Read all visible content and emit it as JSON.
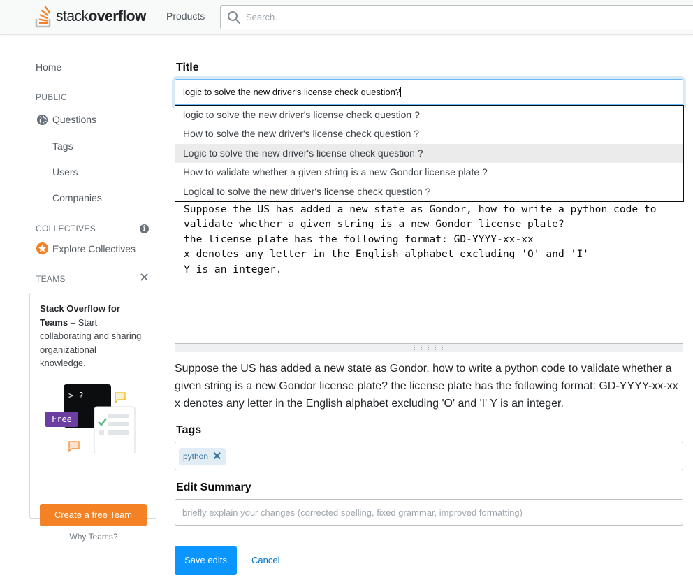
{
  "header": {
    "logo_text_light": "stack",
    "logo_text_bold": "overflow",
    "products_label": "Products",
    "search_placeholder": "Search…",
    "logo_color": "#f48024"
  },
  "sidebar": {
    "home": "Home",
    "public_heading": "PUBLIC",
    "public_items": [
      "Questions",
      "Tags",
      "Users",
      "Companies"
    ],
    "collectives_heading": "COLLECTIVES",
    "explore_collectives": "Explore Collectives",
    "teams_heading": "TEAMS",
    "teams_promo_bold": "Stack Overflow for Teams",
    "teams_promo_rest": " – Start collaborating and sharing organizational knowledge.",
    "illustration_free_badge": "Free",
    "illustration_prompt": ">_?",
    "create_team_button": "Create a free Team",
    "why_teams_link": "Why Teams?"
  },
  "form": {
    "title_label": "Title",
    "title_value": "logic to solve the new driver's license check question?",
    "suggestions": [
      "logic to solve the new driver's license check question ?",
      "How to solve the new driver's license check question ?",
      "Logic to solve the new driver's license check question ?",
      "How to validate whether a given string is a new Gondor license plate ?",
      "Logical to solve the new driver's license check question ?"
    ],
    "highlighted_suggestion_index": 2,
    "body_lines": [
      "Suppose the US has added a new state as Gondor, how to write a python code to",
      "validate whether a given string is a new Gondor license plate?",
      "the license plate has the following format: GD-YYYY-xx-xx",
      "x denotes any letter in the English alphabet excluding 'O' and 'I'",
      "Y is an integer."
    ],
    "preview_text": "Suppose the US has added a new state as Gondor, how to write a python code to validate whether a given string is a new Gondor license plate? the license plate has the following format: GD-YYYY-xx-xx x denotes any letter in the English alphabet excluding 'O' and 'I' Y is an integer.",
    "tags_label": "Tags",
    "tags": [
      "python"
    ],
    "edit_summary_label": "Edit Summary",
    "edit_summary_placeholder": "briefly explain your changes (corrected spelling, fixed grammar, improved formatting)",
    "save_button": "Save edits",
    "cancel_link": "Cancel"
  },
  "colors": {
    "primary_button": "#0a95ff",
    "orange_button": "#f48225",
    "link": "#0074cc",
    "tag_bg": "#e1ecf4",
    "tag_text": "#39739d"
  }
}
